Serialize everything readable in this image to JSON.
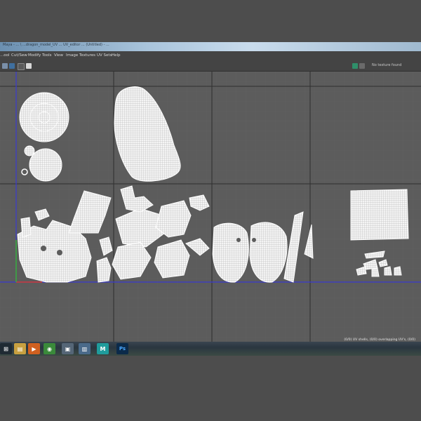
{
  "window": {
    "title": "Maya - ... \\ ...dragon_model_UV ... UV_editor ... (Untitled) - ..."
  },
  "menubar": {
    "items": [
      "...ool",
      "Cut/Sew",
      "Modify",
      "Tools",
      "View",
      "Image",
      "Textures",
      "UV Sets",
      "Help"
    ]
  },
  "toolbar": {
    "texture_label": "No texture found"
  },
  "status": {
    "text": "(0/0) UV shells, (0/0) overlapping UV's, (0/0)"
  },
  "taskbar": {
    "apps": [
      {
        "name": "start",
        "glyph": "⊞"
      },
      {
        "name": "file-explorer",
        "glyph": "▤"
      },
      {
        "name": "media-player",
        "glyph": "▶"
      },
      {
        "name": "chrome",
        "glyph": "◉"
      },
      {
        "name": "app-window",
        "glyph": "▣"
      },
      {
        "name": "files",
        "glyph": "▥"
      },
      {
        "name": "maya",
        "glyph": "M"
      },
      {
        "name": "photoshop",
        "glyph": "Ps"
      }
    ]
  },
  "colors": {
    "viewport_bg": "#5c5c5c",
    "grid_major": "#2e2e2e",
    "grid_minor": "#666666",
    "v_axis": "#3a3ad0",
    "u_axis": "#d03a3a",
    "shell_fill": "#ffffff"
  }
}
